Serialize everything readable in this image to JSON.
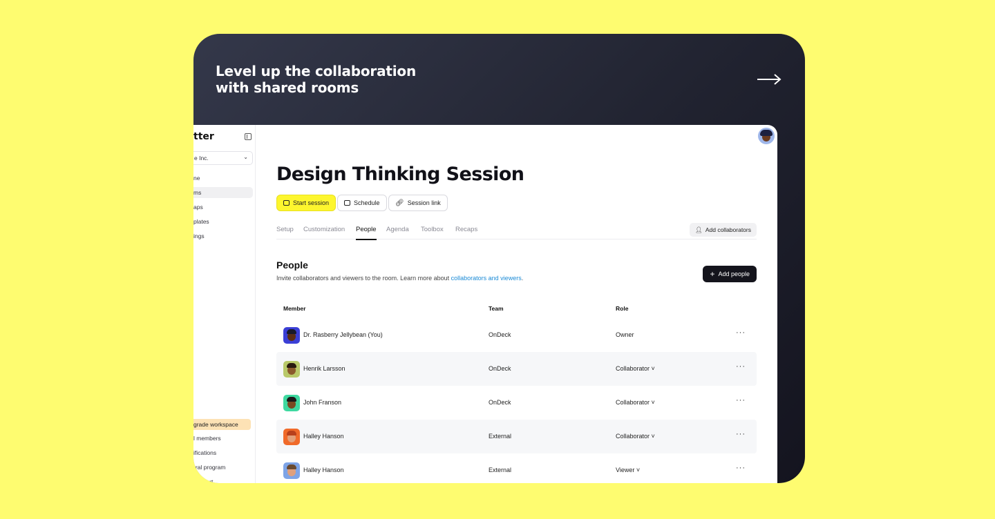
{
  "promo": {
    "headline_line1": "Level up the collaboration",
    "headline_line2": "with shared rooms",
    "arrow_icon": "arrow-right-icon"
  },
  "sidebar": {
    "brand": "tter",
    "workspace": "e Inc.",
    "items": [
      {
        "label": "ne",
        "active": false
      },
      {
        "label": "ms",
        "active": true
      },
      {
        "label": "aps",
        "active": false
      },
      {
        "label": "plates",
        "active": false
      },
      {
        "label": "ings",
        "active": false
      }
    ],
    "upgrade": "grade workspace",
    "bottom_items": [
      "l members",
      "ifications",
      "rral program",
      "support"
    ]
  },
  "page": {
    "title": "Design Thinking Session",
    "buttons": {
      "start": "Start session",
      "schedule": "Schedule",
      "link": "Session link"
    },
    "tabs": [
      {
        "label": "Setup",
        "active": false
      },
      {
        "label": "Customization",
        "active": false
      },
      {
        "label": "People",
        "active": true
      },
      {
        "label": "Agenda",
        "active": false
      },
      {
        "label": "Toolbox",
        "active": false
      },
      {
        "label": "Recaps",
        "active": false
      }
    ],
    "add_collaborators": "Add collaborators"
  },
  "people": {
    "title": "People",
    "desc_prefix": "Invite collaborators and viewers to the room. Learn more about ",
    "desc_link": "collaborators and viewers",
    "desc_suffix": ".",
    "add_button": "Add people",
    "columns": {
      "member": "Member",
      "team": "Team",
      "role": "Role"
    },
    "rows": [
      {
        "name": "Dr. Rasberry Jellybean (You)",
        "team": "OnDeck",
        "role": "Owner",
        "bg": "#3b3fd6",
        "skin": "#5a2d14",
        "hair": "#181a2c"
      },
      {
        "name": "Henrik Larsson",
        "team": "OnDeck",
        "role": "Collaborator ˅",
        "bg": "#b9c96a",
        "skin": "#8a5a2c",
        "hair": "#2a1a10"
      },
      {
        "name": "John Franson",
        "team": "OnDeck",
        "role": "Collaborator ˅",
        "bg": "#3ed9a0",
        "skin": "#7a4a22",
        "hair": "#1a1a1a"
      },
      {
        "name": "Halley Hanson",
        "team": "External",
        "role": "Collaborator ˅",
        "bg": "#f06a2a",
        "skin": "#e3a07a",
        "hair": "#b8401c"
      },
      {
        "name": "Halley Hanson",
        "team": "External",
        "role": "Viewer ˅",
        "bg": "#7ea4e6",
        "skin": "#e0a07c",
        "hair": "#6a4a30"
      }
    ]
  }
}
